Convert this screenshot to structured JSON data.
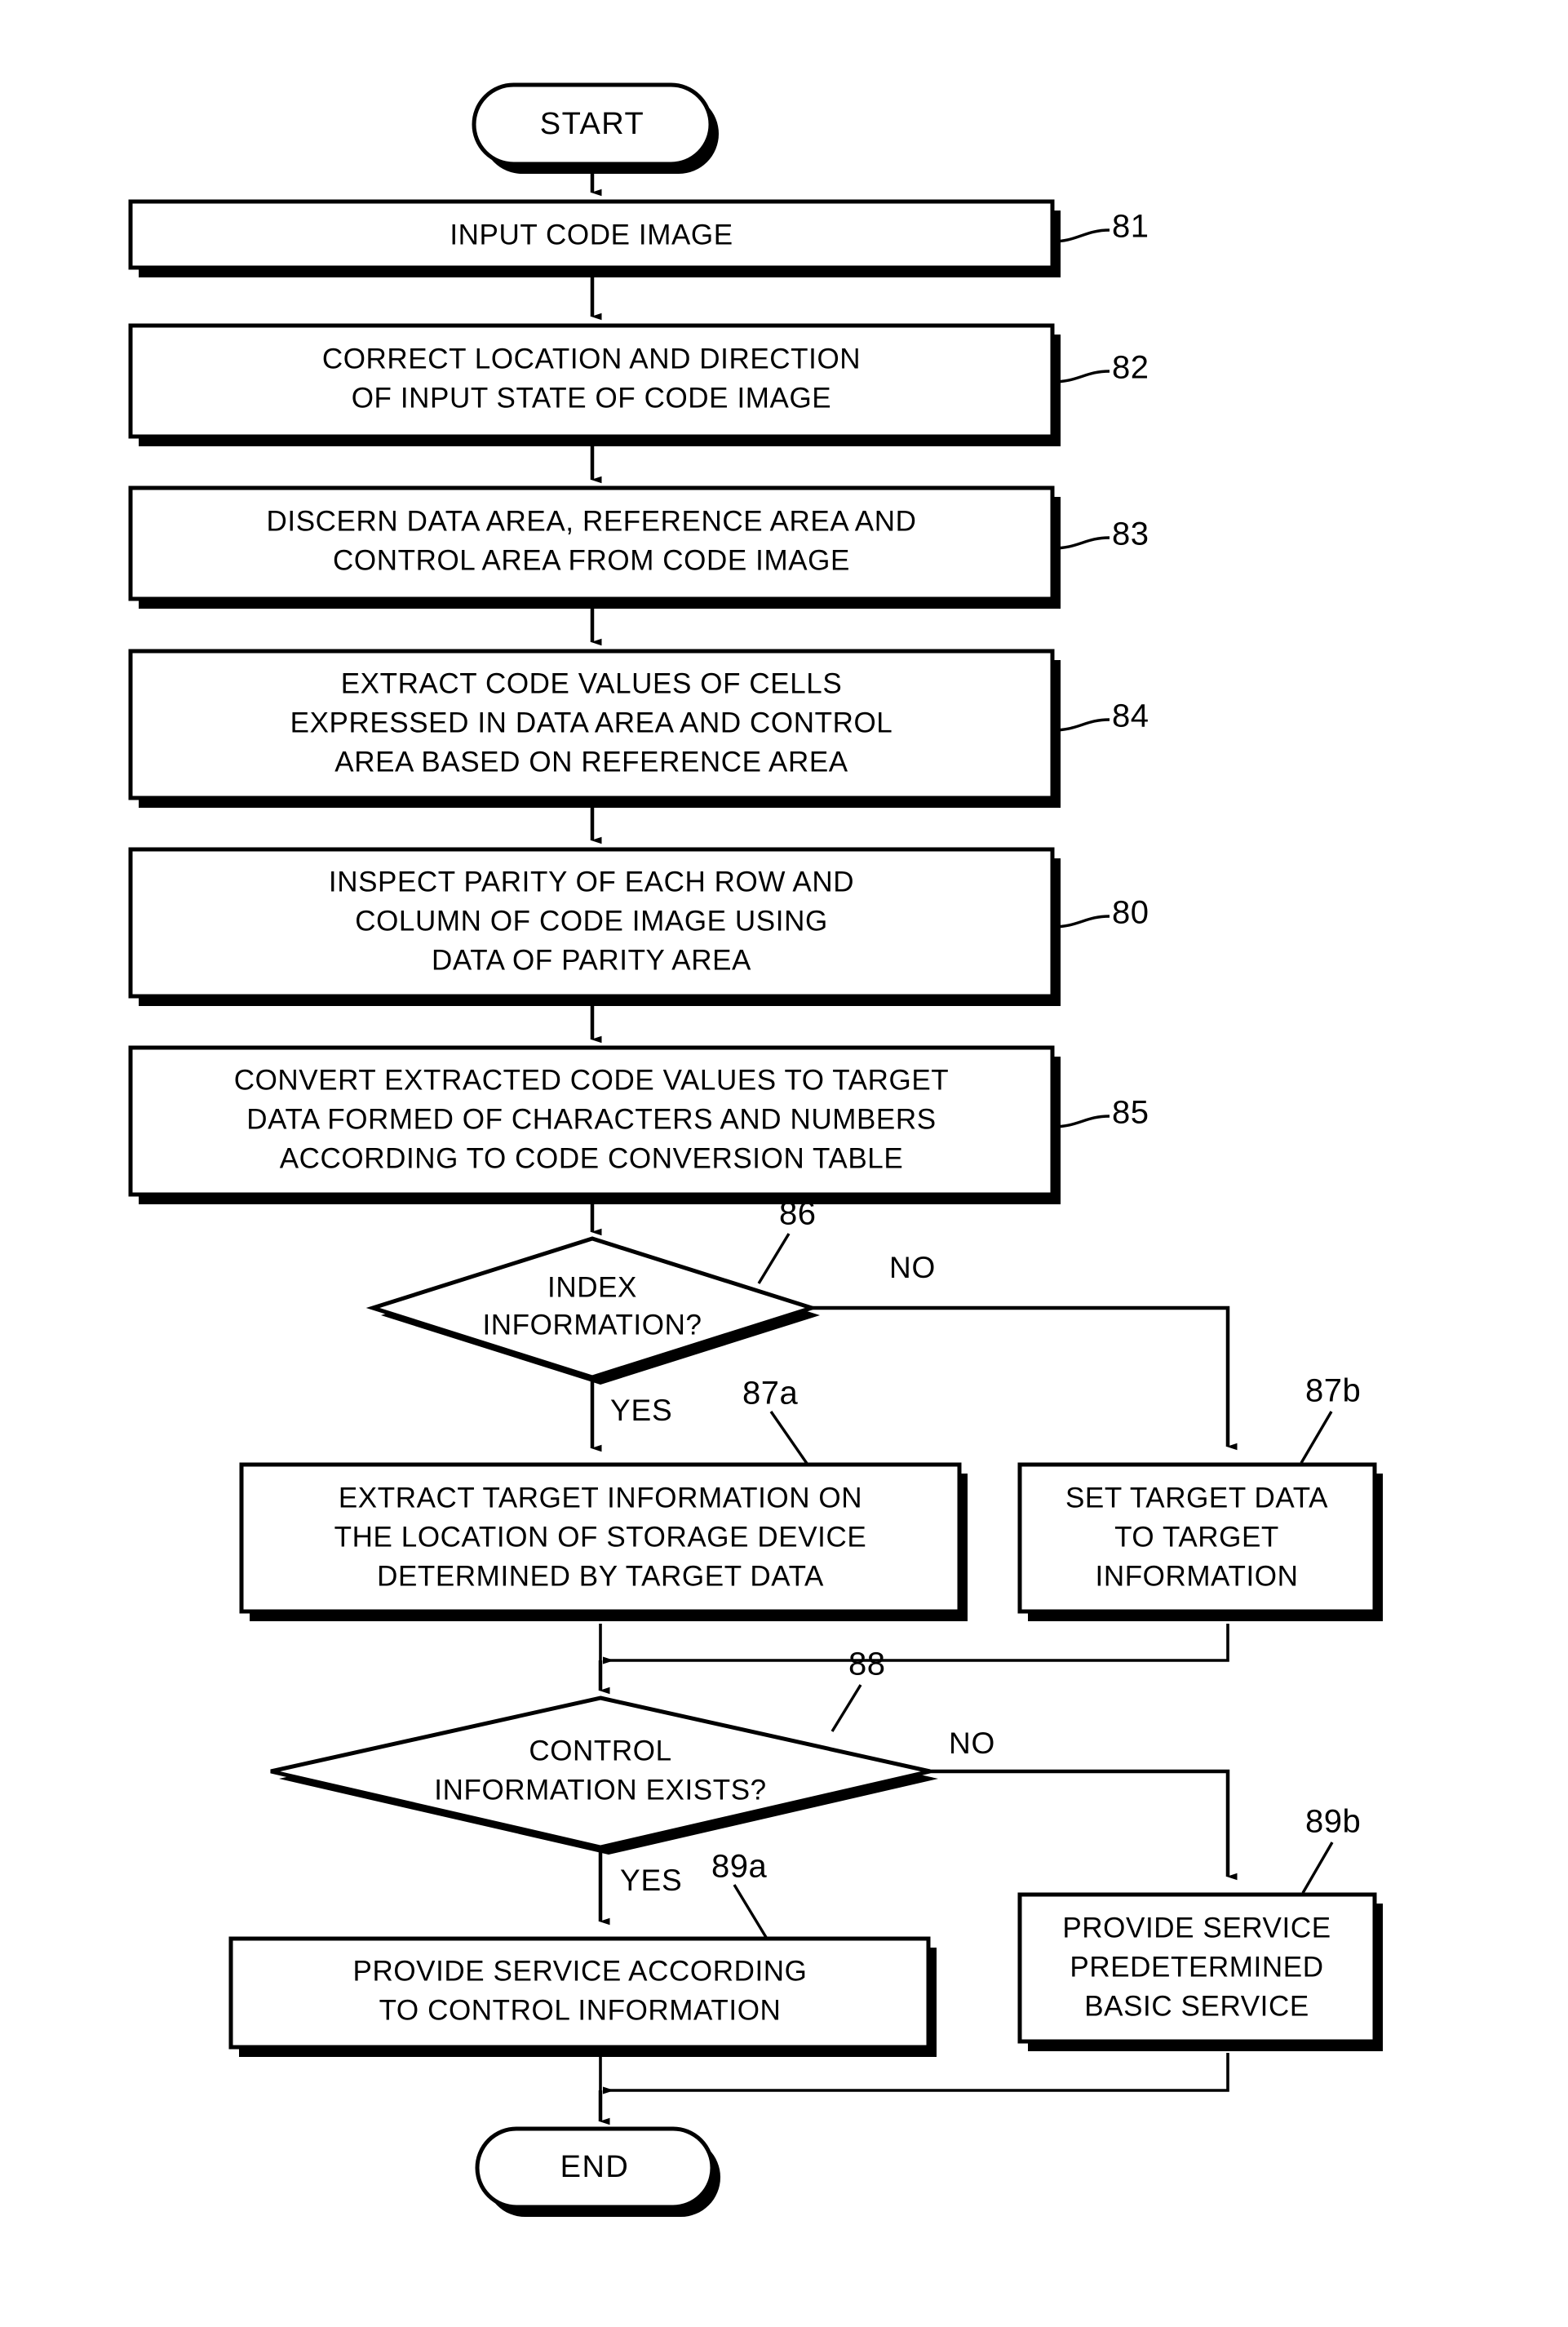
{
  "figure": {
    "type": "flowchart",
    "orientation": "vertical",
    "start_label": "START",
    "end_label": "END"
  },
  "nodes": {
    "start": {
      "label": "START",
      "shape": "terminator"
    },
    "end": {
      "label": "END",
      "shape": "terminator"
    },
    "n81": {
      "ref": "81",
      "shape": "process",
      "lines": [
        "INPUT CODE IMAGE"
      ]
    },
    "n82": {
      "ref": "82",
      "shape": "process",
      "lines": [
        "CORRECT LOCATION AND DIRECTION",
        "OF INPUT STATE OF CODE IMAGE"
      ]
    },
    "n83": {
      "ref": "83",
      "shape": "process",
      "lines": [
        "DISCERN DATA AREA, REFERENCE AREA AND",
        "CONTROL AREA FROM CODE IMAGE"
      ]
    },
    "n84": {
      "ref": "84",
      "shape": "process",
      "lines": [
        "EXTRACT CODE VALUES OF CELLS",
        "EXPRESSED IN DATA AREA AND CONTROL",
        "AREA BASED ON REFERENCE AREA"
      ]
    },
    "n80": {
      "ref": "80",
      "shape": "process",
      "lines": [
        "INSPECT PARITY OF EACH ROW AND",
        "COLUMN OF CODE IMAGE USING",
        "DATA OF PARITY AREA"
      ]
    },
    "n85": {
      "ref": "85",
      "shape": "process",
      "lines": [
        "CONVERT EXTRACTED CODE VALUES TO TARGET",
        "DATA FORMED OF CHARACTERS AND NUMBERS",
        "ACCORDING TO CODE CONVERSION TABLE"
      ]
    },
    "n86": {
      "ref": "86",
      "shape": "decision",
      "lines": [
        "INDEX",
        "INFORMATION?"
      ],
      "yes_label": "YES",
      "no_label": "NO"
    },
    "n87a": {
      "ref": "87a",
      "shape": "process",
      "lines": [
        "EXTRACT TARGET INFORMATION ON",
        "THE LOCATION OF STORAGE DEVICE",
        "DETERMINED BY TARGET DATA"
      ]
    },
    "n87b": {
      "ref": "87b",
      "shape": "process",
      "lines": [
        "SET TARGET DATA",
        "TO TARGET",
        "INFORMATION"
      ]
    },
    "n88": {
      "ref": "88",
      "shape": "decision",
      "lines": [
        "CONTROL",
        "INFORMATION EXISTS?"
      ],
      "yes_label": "YES",
      "no_label": "NO"
    },
    "n89a": {
      "ref": "89a",
      "shape": "process",
      "lines": [
        "PROVIDE SERVICE ACCORDING",
        "TO CONTROL INFORMATION"
      ]
    },
    "n89b": {
      "ref": "89b",
      "shape": "process",
      "lines": [
        "PROVIDE SERVICE",
        "PREDETERMINED",
        "BASIC SERVICE"
      ]
    }
  },
  "colors": {
    "ink": "#000000",
    "paper": "#ffffff"
  }
}
